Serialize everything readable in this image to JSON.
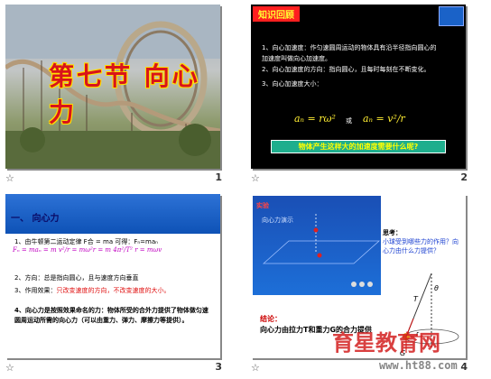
{
  "slides": [
    {
      "number": "1",
      "title": "第七节 向心力"
    },
    {
      "number": "2",
      "header": "知识回顾",
      "items": [
        "1、向心加速度：作匀速圆周运动的物体具有沿半径指向圆心的加速度叫做向心加速度。",
        "2、向心加速度的方向：指向圆心，且每时每刻在不断变化。",
        "3、向心加速度大小："
      ],
      "formula_a": "aₙ = rω²",
      "or": "或",
      "formula_b": "aₙ = v²/r",
      "question": "物体产生这样大的加速度需要什么呢?"
    },
    {
      "number": "3",
      "heading": "一、 向心力",
      "line1": "1、由牛顿第二运动定律 F合 = ma 可得：Fₙ=maₙ",
      "formula": "Fₙ = maₙ = m v²/r = mω²r = m 4π²/T² r = mωv",
      "line2": "2、方向：总是指向圆心，且与速度方向垂直",
      "line3_a": "3、作用效果：",
      "line3_b": "只改变速度的方向，不改变速度的大小。",
      "line4": "4、向心力是按照效果命名的力：物体所受的合外力提供了物体做匀速圆周运动所需的向心力（可以由重力、弹力、摩擦力等提供）。"
    },
    {
      "number": "4",
      "panel_title": "实验",
      "panel_sub": "向心力演示",
      "think": "思考：",
      "q": "小球受到哪些力的作用？向心力由什么力提供？",
      "conc_label": "结论：",
      "conc": "向心力由拉力T和重力G的合力提供",
      "label_T": "T",
      "label_G": "G",
      "label_theta": "θ",
      "label_r": "r"
    }
  ],
  "footer_icon": "star-icon",
  "watermark": {
    "main": "育星教育网",
    "url": "www.ht88.com"
  }
}
